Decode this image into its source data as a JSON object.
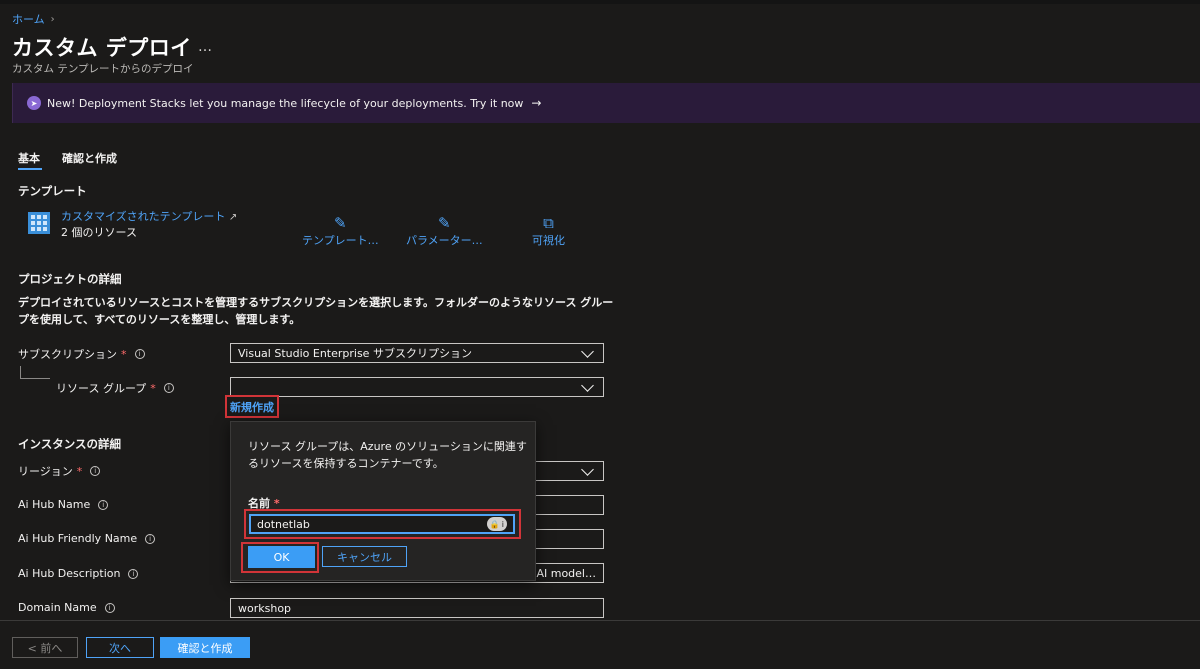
{
  "breadcrumb": {
    "home": "ホーム",
    "separator": "›"
  },
  "page": {
    "title": "カスタム デプロイ",
    "more": "…",
    "subtitle": "カスタム テンプレートからのデプロイ"
  },
  "banner": {
    "icon": "rocket-icon",
    "text": "New! Deployment Stacks let you manage the lifecycle of your deployments. Try it now",
    "arrow": "→"
  },
  "tabs": [
    {
      "label": "基本",
      "active": true
    },
    {
      "label": "確認と作成",
      "active": false
    }
  ],
  "template": {
    "heading": "テンプレート",
    "link": "カスタマイズされたテンプレート",
    "external_icon": "↗",
    "resource_count": "2 個のリソース",
    "actions": [
      {
        "label": "テンプレート…",
        "icon": "pencil-icon",
        "glyph": "✎"
      },
      {
        "label": "パラメーター…",
        "icon": "pencil-icon",
        "glyph": "✎"
      },
      {
        "label": "可視化",
        "icon": "hierarchy-icon",
        "glyph": "⧉"
      }
    ]
  },
  "project": {
    "heading": "プロジェクトの詳細",
    "description": "デプロイされているリソースとコストを管理するサブスクリプションを選択します。フォルダーのようなリソース グループを使用して、すべてのリソースを整理し、管理します。",
    "subscription_label": "サブスクリプション",
    "subscription_value": "Visual Studio Enterprise サブスクリプション",
    "resource_group_label": "リソース グループ",
    "resource_group_value": "",
    "new_link": "新規作成"
  },
  "instance": {
    "heading": "インスタンスの詳細",
    "region_label": "リージョン",
    "hub_name_label": "Ai Hub Name",
    "hub_friendly_label": "Ai Hub Friendly Name",
    "hub_desc_label": "Ai Hub Description",
    "hub_desc_value": "AI model…",
    "domain_label": "Domain Name",
    "domain_value": "workshop"
  },
  "popup": {
    "text": "リソース グループは、Azure のソリューションに関連するリソースを保持するコンテナーです。",
    "name_label": "名前",
    "name_value": "dotnetlab",
    "ok": "OK",
    "cancel": "キャンセル"
  },
  "required_mark": "*",
  "info_mark": "i",
  "footer": {
    "prev": "< 前へ",
    "next": "次へ",
    "review": "確認と作成"
  },
  "colors": {
    "accent": "#4fa3f7",
    "primary_button": "#3b9df5",
    "highlight_red": "#d13438",
    "banner_bg": "#2a1b3a"
  }
}
